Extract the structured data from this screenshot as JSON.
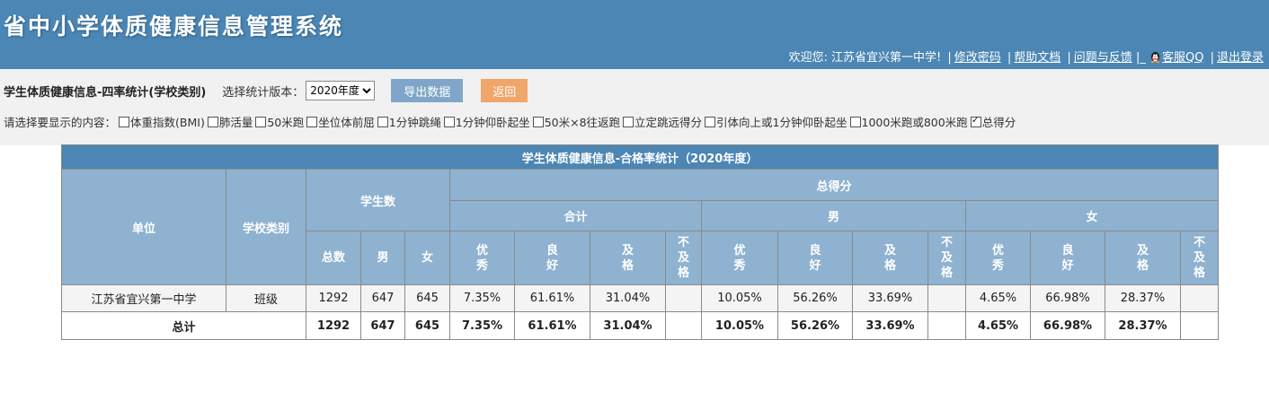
{
  "app": {
    "title": "省中小学体质健康信息管理系统",
    "welcome": "欢迎您: 江苏省宜兴第一中学!",
    "links": {
      "change_password": "修改密码",
      "help": "帮助文档",
      "feedback": "问题与反馈",
      "qq": "客服QQ",
      "logout": "退出登录"
    },
    "sep_bar": "|",
    "sep_under": "_"
  },
  "toolbar": {
    "page_title": "学生体质健康信息-四率统计(学校类别)",
    "version_label": "选择统计版本：",
    "version_value": "2020年度",
    "export_label": "导出数据",
    "back_label": "返回"
  },
  "options": {
    "prompt": "请选择要显示的内容：",
    "items": [
      {
        "label": "体重指数(BMI)",
        "checked": false
      },
      {
        "label": "肺活量",
        "checked": false
      },
      {
        "label": "50米跑",
        "checked": false
      },
      {
        "label": "坐位体前屈",
        "checked": false
      },
      {
        "label": "1分钟跳绳",
        "checked": false
      },
      {
        "label": "1分钟仰卧起坐",
        "checked": false
      },
      {
        "label": "50米×8往返跑",
        "checked": false
      },
      {
        "label": "立定跳远得分",
        "checked": false
      },
      {
        "label": "引体向上或1分钟仰卧起坐",
        "checked": false
      },
      {
        "label": "1000米跑或800米跑",
        "checked": false
      },
      {
        "label": "总得分",
        "checked": true
      }
    ]
  },
  "table": {
    "caption": "学生体质健康信息-合格率统计（2020年度）",
    "headers": {
      "unit": "单位",
      "school_type": "学校类别",
      "students": "学生数",
      "total_score": "总得分",
      "group_all": "合计",
      "group_male": "男",
      "group_female": "女",
      "total": "总数",
      "male": "男",
      "female": "女",
      "excellent": "优秀",
      "good": "良好",
      "pass": "及格",
      "fail": "不及格"
    },
    "rows": [
      {
        "unit": "江苏省宜兴第一中学",
        "type": "班级",
        "total": "1292",
        "male": "647",
        "female": "645",
        "all": [
          "7.35%",
          "61.61%",
          "31.04%",
          ""
        ],
        "m": [
          "10.05%",
          "56.26%",
          "33.69%",
          ""
        ],
        "f": [
          "4.65%",
          "66.98%",
          "28.37%",
          ""
        ]
      }
    ],
    "total_row": {
      "label": "总计",
      "total": "1292",
      "male": "647",
      "female": "645",
      "all": [
        "7.35%",
        "61.61%",
        "31.04%",
        ""
      ],
      "m": [
        "10.05%",
        "56.26%",
        "33.69%",
        ""
      ],
      "f": [
        "4.65%",
        "66.98%",
        "28.37%",
        ""
      ]
    }
  }
}
